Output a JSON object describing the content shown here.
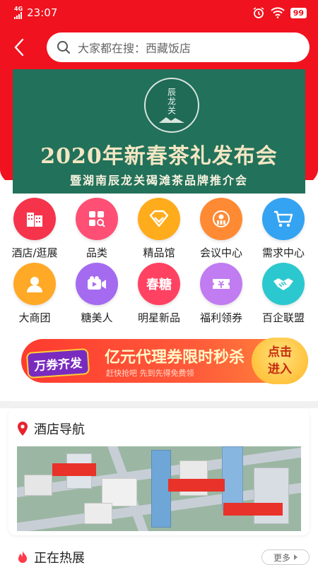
{
  "status": {
    "network": "4G",
    "time": "23:07",
    "battery": "99"
  },
  "search": {
    "placeholder": "大家都在搜：西藏饭店"
  },
  "banner": {
    "logo_text": "辰龙关",
    "title": "2020年新春茶礼发布会",
    "subtitle": "暨湖南辰龙关碣滩茶品牌推介会"
  },
  "categories": [
    {
      "label": "酒店/逛展",
      "color": "#f5344c",
      "icon": "building-icon"
    },
    {
      "label": "品类",
      "color": "#ff4f74",
      "icon": "grid-search-icon"
    },
    {
      "label": "精品馆",
      "color": "#ffac1c",
      "icon": "diamond-icon"
    },
    {
      "label": "会议中心",
      "color": "#ff8a34",
      "icon": "person-badge-icon"
    },
    {
      "label": "需求中心",
      "color": "#33a3f2",
      "icon": "cart-icon"
    },
    {
      "label": "大商团",
      "color": "#ffa927",
      "icon": "user-icon"
    },
    {
      "label": "糖美人",
      "color": "#a46bf0",
      "icon": "video-icon"
    },
    {
      "label": "明星新品",
      "color": "#ff4262",
      "icon": "spring-text-icon",
      "icon_text": "春糖"
    },
    {
      "label": "福利领券",
      "color": "#c07cf0",
      "icon": "coupon-icon"
    },
    {
      "label": "百企联盟",
      "color": "#2cc8cf",
      "icon": "handshake-icon"
    }
  ],
  "promo": {
    "badge": "万券齐发",
    "title": "亿元代理券限时秒杀",
    "subtitle": "赶快抢吧 先到先得免费领",
    "button": "点击进入"
  },
  "hotel_nav": {
    "title": "酒店导航"
  },
  "hot_section": {
    "title": "正在热展",
    "more": "更多"
  }
}
